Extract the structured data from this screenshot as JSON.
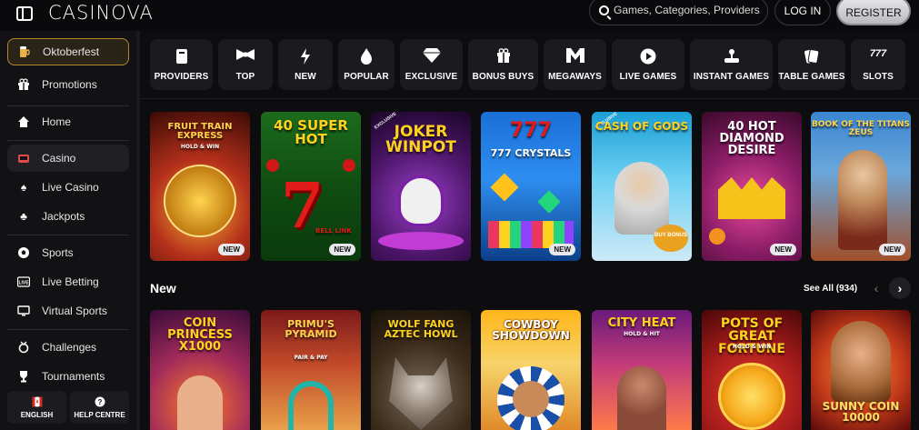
{
  "header": {
    "logo": "CASINOVA",
    "search_placeholder": "Games, Categories, Providers",
    "login": "LOG IN",
    "register": "REGISTER"
  },
  "sidebar": {
    "items": [
      {
        "label": "Oktoberfest",
        "icon": "beer-mug-icon"
      },
      {
        "label": "Promotions",
        "icon": "gift-icon"
      },
      {
        "label": "Home",
        "icon": "home-icon"
      },
      {
        "label": "Casino",
        "icon": "slot-icon"
      },
      {
        "label": "Live Casino",
        "icon": "spade-icon"
      },
      {
        "label": "Jackpots",
        "icon": "clover-icon"
      },
      {
        "label": "Sports",
        "icon": "soccer-ball-icon"
      },
      {
        "label": "Live Betting",
        "icon": "live-icon"
      },
      {
        "label": "Virtual Sports",
        "icon": "monitor-icon"
      },
      {
        "label": "Challenges",
        "icon": "medal-icon"
      },
      {
        "label": "Tournaments",
        "icon": "trophy-icon"
      }
    ],
    "language": "ENGLISH",
    "help": "HELP CENTRE"
  },
  "categories": [
    {
      "label": "PROVIDERS",
      "icon": "book-icon"
    },
    {
      "label": "TOP",
      "icon": "bow-tie-icon"
    },
    {
      "label": "NEW",
      "icon": "lightning-icon"
    },
    {
      "label": "POPULAR",
      "icon": "flame-icon"
    },
    {
      "label": "EXCLUSIVE",
      "icon": "diamond-icon"
    },
    {
      "label": "BONUS BUYS",
      "icon": "gift-box-icon"
    },
    {
      "label": "MEGAWAYS",
      "icon": "m-icon"
    },
    {
      "label": "LIVE GAMES",
      "icon": "play-icon"
    },
    {
      "label": "INSTANT GAMES",
      "icon": "joystick-icon"
    },
    {
      "label": "TABLE GAMES",
      "icon": "cards-icon"
    },
    {
      "label": "SLOTS",
      "icon": "777-icon"
    }
  ],
  "top_games": [
    {
      "title": "FRUIT TRAIN EXPRESS",
      "sub": "HOLD & WIN",
      "badge": "NEW",
      "exclusive": ""
    },
    {
      "title": "40 SUPER HOT",
      "sub": "BELL LINK",
      "badge": "NEW",
      "exclusive": ""
    },
    {
      "title": "JOKER WINPOT",
      "sub": "",
      "badge": "",
      "exclusive": "EXCLUSIVE"
    },
    {
      "title": "777 CRYSTALS",
      "sub": "",
      "badge": "NEW",
      "exclusive": ""
    },
    {
      "title": "CASH OF GODS",
      "sub": "BUY BONUS",
      "badge": "",
      "exclusive": "EXCLUSIVE"
    },
    {
      "title": "40 HOT DIAMOND DESIRE",
      "sub": "",
      "badge": "NEW",
      "exclusive": ""
    },
    {
      "title": "BOOK OF THE TITANS ZEUS",
      "sub": "",
      "badge": "NEW",
      "exclusive": ""
    }
  ],
  "new_section": {
    "title": "New",
    "see_all": "See All (934)"
  },
  "new_games": [
    {
      "title": "COIN PRINCESS X1000"
    },
    {
      "title": "PRIMU'S PYRAMID",
      "sub": "PAIR & PAY"
    },
    {
      "title": "WOLF FANG AZTEC HOWL"
    },
    {
      "title": "COWBOY SHOWDOWN"
    },
    {
      "title": "CITY HEAT",
      "sub": "HOLD & HIT"
    },
    {
      "title": "POTS OF GREAT FORTUNE",
      "sub": "HOLD & WIN"
    },
    {
      "title": "SUNNY COIN 10000"
    }
  ]
}
